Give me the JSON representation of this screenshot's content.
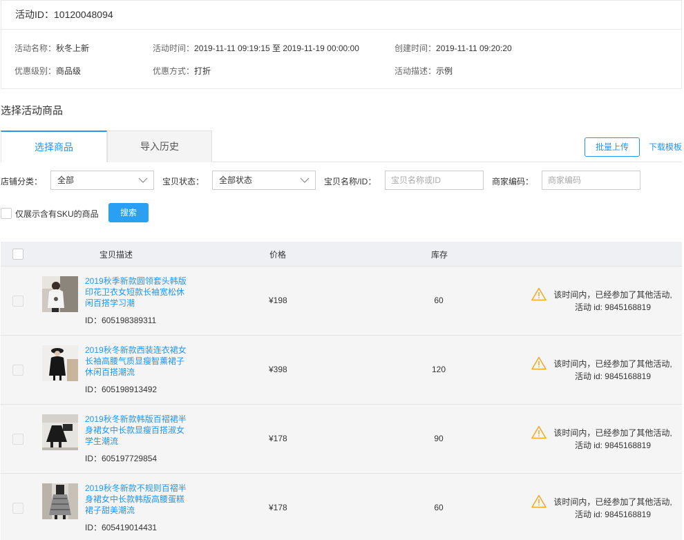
{
  "activity": {
    "id_label": "活动ID：",
    "id_value": "10120048094",
    "name_label": "活动名称：",
    "name_value": "秋冬上新",
    "time_label": "活动时间：",
    "time_value": "2019-11-11 09:19:15 至 2019-11-19 00:00:00",
    "created_label": "创建时间：",
    "created_value": "2019-11-11 09:20:20",
    "level_label": "优惠级别：",
    "level_value": "商品级",
    "method_label": "优惠方式：",
    "method_value": "打折",
    "desc_label": "活动描述：",
    "desc_value": "示例"
  },
  "section_title": "选择活动商品",
  "tabs": [
    {
      "label": "选择商品",
      "active": true
    },
    {
      "label": "导入历史",
      "active": false
    }
  ],
  "actions": {
    "batch_upload": "批量上传",
    "download_template": "下载模板"
  },
  "filters": {
    "category_label": "店铺分类：",
    "category_value": "全部",
    "status_label": "宝贝状态：",
    "status_value": "全部状态",
    "name_label": "宝贝名称/ID：",
    "name_placeholder": "宝贝名称或ID",
    "code_label": "商家编码：",
    "code_placeholder": "商家编码",
    "sku_only_label": "仅展示含有SKU的商品",
    "search_button": "搜索"
  },
  "table": {
    "headers": {
      "desc": "宝贝描述",
      "price": "价格",
      "stock": "库存"
    },
    "rows": [
      {
        "name": "2019秋季新款圆领套头韩版印花卫衣女短款长袖宽松休闲百搭学习潮",
        "id": "ID：605198389311",
        "price": "¥198",
        "stock": "60",
        "warning_line1": "该时间内，已经参加了其他活动,",
        "warning_line2": "活动 id: 9845168819"
      },
      {
        "name": "2019秋冬新款西装连衣裙女长袖高腰气质显瘦智薰裙子休闲百搭潮流",
        "id": "ID：605198913492",
        "price": "¥398",
        "stock": "120",
        "warning_line1": "该时间内，已经参加了其他活动,",
        "warning_line2": "活动 id: 9845168819"
      },
      {
        "name": "2019秋冬新款韩版百褶裙半身裙女中长款显瘦百搭淑女学生潮流",
        "id": "ID：605197729854",
        "price": "¥178",
        "stock": "90",
        "warning_line1": "该时间内，已经参加了其他活动,",
        "warning_line2": "活动 id: 9845168819"
      },
      {
        "name": "2019秋冬新款不规则百褶半身裙女中长款韩版高腰蛋糕裙子甜美潮流",
        "id": "ID：605419014431",
        "price": "¥178",
        "stock": "60",
        "warning_line1": "该时间内，已经参加了其他活动,",
        "warning_line2": "活动 id: 9845168819"
      }
    ]
  },
  "colors": {
    "accent": "#2196f3",
    "warning": "#f5a623",
    "row_bg": "#f5f5f5",
    "header_bg": "#eef0f3"
  }
}
